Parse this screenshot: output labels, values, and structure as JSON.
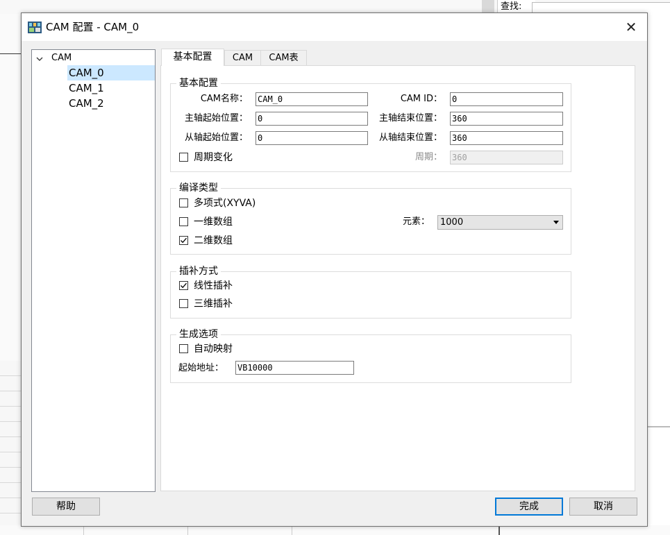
{
  "background": {
    "find_label": "查找:"
  },
  "dialog": {
    "title": "CAM 配置 - CAM_0",
    "close_glyph": "✕"
  },
  "tree": {
    "root_label": "CAM",
    "root_chevron": "⌄",
    "items": [
      "CAM_0",
      "CAM_1",
      "CAM_2"
    ],
    "selected_index": 0
  },
  "tabs": [
    "基本配置",
    "CAM",
    "CAM表"
  ],
  "basic_group": {
    "title": "基本配置",
    "cam_name_label": "CAM名称：",
    "cam_name_value": "CAM_0",
    "cam_id_label": "CAM ID：",
    "cam_id_value": "0",
    "master_start_label": "主轴起始位置：",
    "master_start_value": "0",
    "master_end_label": "主轴结束位置：",
    "master_end_value": "360",
    "slave_start_label": "从轴起始位置：",
    "slave_start_value": "0",
    "slave_end_label": "从轴结束位置：",
    "slave_end_value": "360",
    "periodic_label": "周期变化",
    "periodic_checked": false,
    "period_label": "周期：",
    "period_value": "360"
  },
  "compile_group": {
    "title": "编译类型",
    "polynomial_label": "多项式(XYVA)",
    "polynomial_checked": false,
    "array1d_label": "一维数组",
    "array1d_checked": false,
    "array2d_label": "二维数组",
    "array2d_checked": true,
    "elements_label": "元素：",
    "elements_value": "1000"
  },
  "interp_group": {
    "title": "插补方式",
    "linear_label": "线性插补",
    "linear_checked": true,
    "cubic_label": "三维插补",
    "cubic_checked": false
  },
  "gen_group": {
    "title": "生成选项",
    "auto_map_label": "自动映射",
    "auto_map_checked": false,
    "start_addr_label": "起始地址：",
    "start_addr_value": "VB10000"
  },
  "buttons": {
    "help": "帮助",
    "finish": "完成",
    "cancel": "取消"
  },
  "colors": {
    "selection": "#cce8ff",
    "default_button_border": "#0078d7",
    "dialog_bg": "#f0f0f0"
  }
}
